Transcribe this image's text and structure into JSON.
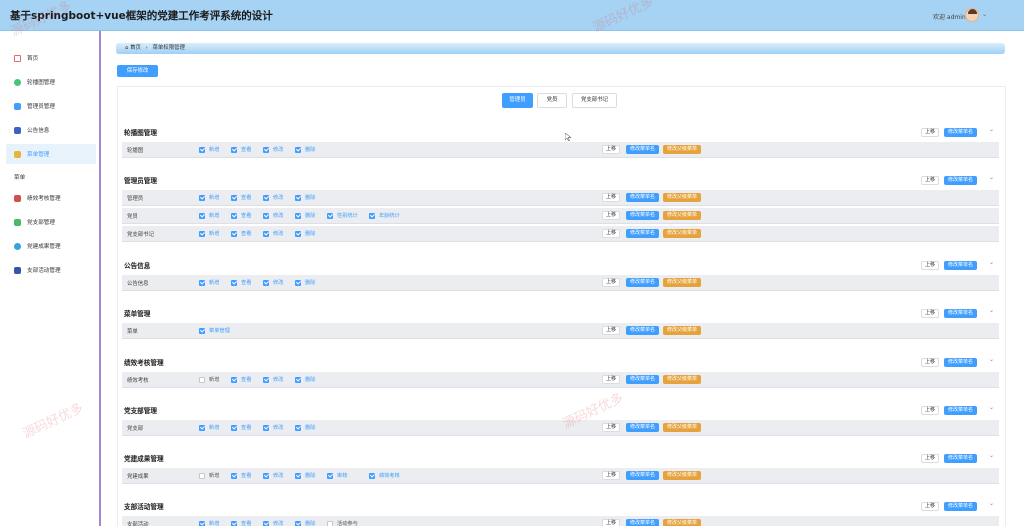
{
  "header": {
    "title": "基于springboot+vue框架的党建工作考评系统的设计",
    "welcome": "欢迎 admin",
    "caret": "⌄"
  },
  "sidebar": {
    "items": [
      {
        "label": "首页",
        "icon": "home-icon",
        "color": "#e06c6c"
      },
      {
        "label": "轮播图管理",
        "icon": "carousel-icon",
        "color": "#4cc37a"
      },
      {
        "label": "管理员管理",
        "icon": "admin-icon",
        "color": "#409eff"
      },
      {
        "label": "公告信息",
        "icon": "notice-icon",
        "color": "#3a63c4"
      },
      {
        "label": "菜单管理",
        "icon": "menu-icon",
        "color": "#e8b53c"
      }
    ],
    "group_label": "菜单",
    "group_items": [
      {
        "label": "绩效考核管理",
        "icon": "performance-icon",
        "color": "#d0504f"
      },
      {
        "label": "党支部管理",
        "icon": "branch-icon",
        "color": "#4cb86a"
      },
      {
        "label": "党建成果管理",
        "icon": "achievement-icon",
        "color": "#36a3d9"
      },
      {
        "label": "支部活动管理",
        "icon": "activity-icon",
        "color": "#3a55a8"
      }
    ]
  },
  "breadcrumb": {
    "home": "⌂ 首页",
    "sep": "›",
    "current": "菜单权限管理"
  },
  "toolbar": {
    "save_label": "保存修改"
  },
  "role_tabs": [
    "管理员",
    "党员",
    "党支部书记"
  ],
  "labels": {
    "up": "上移",
    "rename": "修改菜单名",
    "parent": "修改父级菜单"
  },
  "modules": [
    {
      "title": "轮播图管理",
      "rows": [
        {
          "name": "轮播图",
          "perms": [
            [
              "新增",
              true
            ],
            [
              "查看",
              true
            ],
            [
              "修改",
              true
            ],
            [
              "删除",
              true
            ]
          ]
        }
      ]
    },
    {
      "title": "管理员管理",
      "rows": [
        {
          "name": "管理员",
          "perms": [
            [
              "新增",
              true
            ],
            [
              "查看",
              true
            ],
            [
              "修改",
              true
            ],
            [
              "删除",
              true
            ]
          ]
        },
        {
          "name": "党员",
          "perms": [
            [
              "新增",
              true
            ],
            [
              "查看",
              true
            ],
            [
              "修改",
              true
            ],
            [
              "删除",
              true
            ],
            [
              "性别统计",
              true
            ],
            [
              "年龄统计",
              true
            ]
          ]
        },
        {
          "name": "党支部书记",
          "perms": [
            [
              "新增",
              true
            ],
            [
              "查看",
              true
            ],
            [
              "修改",
              true
            ],
            [
              "删除",
              true
            ]
          ]
        }
      ]
    },
    {
      "title": "公告信息",
      "rows": [
        {
          "name": "公告信息",
          "perms": [
            [
              "新增",
              true
            ],
            [
              "查看",
              true
            ],
            [
              "修改",
              true
            ],
            [
              "删除",
              true
            ]
          ]
        }
      ]
    },
    {
      "title": "菜单管理",
      "rows": [
        {
          "name": "菜单",
          "perms": [
            [
              "菜单管理",
              true
            ]
          ]
        }
      ]
    },
    {
      "title": "绩效考核管理",
      "rows": [
        {
          "name": "绩效考核",
          "perms": [
            [
              "新增",
              false
            ],
            [
              "查看",
              true
            ],
            [
              "修改",
              true
            ],
            [
              "删除",
              true
            ]
          ]
        }
      ]
    },
    {
      "title": "党支部管理",
      "rows": [
        {
          "name": "党支部",
          "perms": [
            [
              "新增",
              true
            ],
            [
              "查看",
              true
            ],
            [
              "修改",
              true
            ],
            [
              "删除",
              true
            ]
          ]
        }
      ]
    },
    {
      "title": "党建成果管理",
      "rows": [
        {
          "name": "党建成果",
          "perms": [
            [
              "新增",
              false
            ],
            [
              "查看",
              true
            ],
            [
              "修改",
              true
            ],
            [
              "删除",
              true
            ],
            [
              "审核",
              true
            ],
            [
              "绩效考核",
              true
            ]
          ]
        }
      ]
    },
    {
      "title": "支部活动管理",
      "rows": [
        {
          "name": "支部活动",
          "perms": [
            [
              "新增",
              true
            ],
            [
              "查看",
              true
            ],
            [
              "修改",
              true
            ],
            [
              "删除",
              true
            ],
            [
              "活动参与",
              false
            ]
          ]
        }
      ]
    }
  ],
  "watermark": "源码好优多",
  "colors": {
    "primary": "#409eff",
    "warning": "#e6a23c",
    "header": "#a6d2f3",
    "sidebar_border": "#a884d6"
  }
}
